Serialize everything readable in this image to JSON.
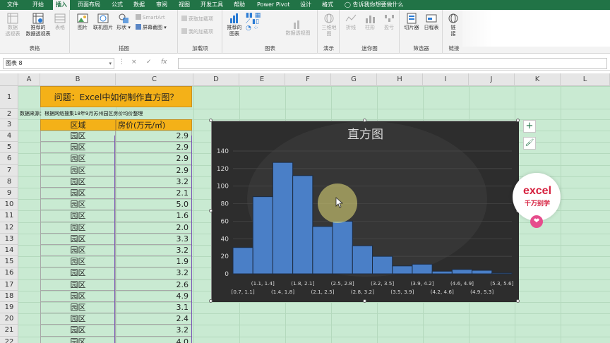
{
  "tabs": [
    "文件",
    "开始",
    "插入",
    "页面布局",
    "公式",
    "数据",
    "审阅",
    "视图",
    "开发工具",
    "帮助",
    "Power Pivot",
    "设计",
    "格式"
  ],
  "active_tab": "插入",
  "tell_me": "告诉我你想要做什么",
  "ribbon": {
    "groups": {
      "tables": "表格",
      "illustrations": "插图",
      "addins": "加载项",
      "charts": "图表",
      "tours": "演示",
      "sparklines": "迷你图",
      "filters": "筛选器",
      "links": "链接"
    },
    "buttons": {
      "pivot_table": "数据\n透视表",
      "recommended_pivot": "推荐的\n数据透视表",
      "table": "表格",
      "pictures": "图片",
      "online_pictures": "联机图片",
      "shapes": "形状",
      "smartart": "SmartArt",
      "screenshot": "屏幕截图",
      "get_addins": "获取加载项",
      "my_addins": "我的加载项",
      "recommended_charts": "推荐的\n图表",
      "pivot_chart": "数据透视图",
      "map_3d": "三维地\n图",
      "line": "折线",
      "column": "柱形",
      "winloss": "盈亏",
      "slicer": "切片器",
      "timeline": "日程表",
      "link": "链\n接"
    }
  },
  "formula_bar": {
    "name_box": "图表 8",
    "cancel": "×",
    "enter": "✓",
    "fx": "fx",
    "content": ""
  },
  "columns": [
    "A",
    "B",
    "C",
    "D",
    "E",
    "F",
    "G",
    "H",
    "I",
    "J",
    "K",
    "L"
  ],
  "rows": [
    "1",
    "2",
    "3",
    "4",
    "5",
    "6",
    "7",
    "8",
    "9",
    "10",
    "11",
    "12",
    "13",
    "14",
    "15",
    "16",
    "17",
    "18",
    "19",
    "20",
    "21",
    "22"
  ],
  "sheet": {
    "title": "问题：Excel中如何制作直方图？",
    "source": "数据来源：根据网络搜集18年9月苏州园区房价均价整理",
    "header_region": "区域",
    "header_price": "房价(万元/㎡)",
    "region_values": [
      "园区",
      "园区",
      "园区",
      "园区",
      "园区",
      "园区",
      "园区",
      "园区",
      "园区",
      "园区",
      "园区",
      "园区",
      "园区",
      "园区",
      "园区",
      "园区",
      "园区",
      "园区",
      "园区"
    ],
    "price_values": [
      "2.9",
      "2.9",
      "2.9",
      "2.9",
      "3.2",
      "2.1",
      "5.0",
      "1.6",
      "2.0",
      "3.3",
      "3.2",
      "1.9",
      "3.2",
      "2.6",
      "4.9",
      "3.1",
      "2.4",
      "3.2",
      "4.0"
    ]
  },
  "chart_data": {
    "type": "bar",
    "title": "直方图",
    "categories": [
      "[0.7, 1.1]",
      "(1.1, 1.4]",
      "(1.4, 1.8]",
      "(1.8, 2.1]",
      "(2.1, 2.5]",
      "(2.5, 2.8]",
      "(2.8, 3.2]",
      "(3.2, 3.5]",
      "(3.5, 3.9]",
      "(3.9, 4.2]",
      "(4.2, 4.6]",
      "(4.6, 4.9]",
      "(4.9, 5.3]",
      "(5.3, 5.6]"
    ],
    "values": [
      30,
      88,
      127,
      112,
      54,
      60,
      32,
      20,
      9,
      11,
      3,
      5,
      4,
      1
    ],
    "y_ticks": [
      "0",
      "20",
      "40",
      "60",
      "80",
      "100",
      "120",
      "140"
    ],
    "ylim": [
      0,
      140
    ],
    "grid": true,
    "colors": {
      "bar": "#4a7fc7",
      "bar_edge": "#1d2d44",
      "background": "#2d2d2d",
      "text": "#d9d9d9"
    }
  },
  "chart_buttons": {
    "add_element": "+",
    "style": "🖌"
  },
  "logo": {
    "line1": "excel",
    "line2": "千万别学",
    "heart": "❤"
  }
}
